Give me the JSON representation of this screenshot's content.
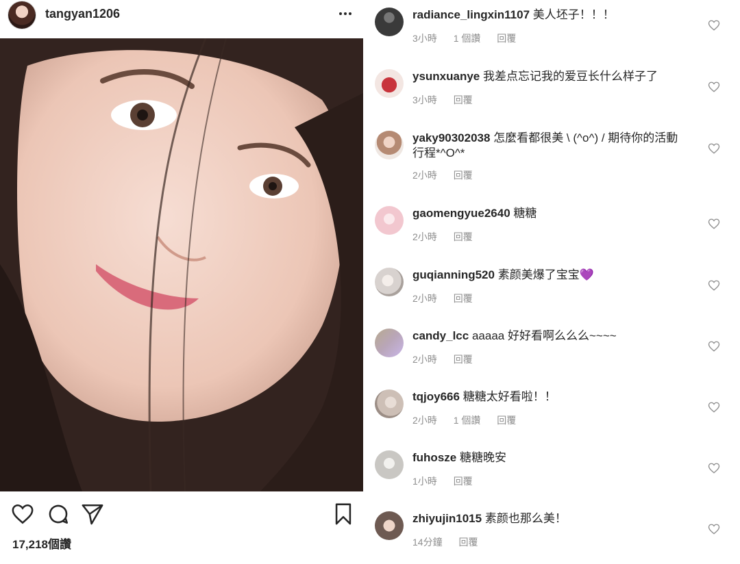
{
  "post": {
    "username": "tangyan1206",
    "likes": "17,218個讚"
  },
  "comments": [
    {
      "user": "radiance_lingxin1107",
      "text": "美人坯子！！！",
      "time": "3小時",
      "likes": "1 個讚",
      "reply": "回覆",
      "avatar_color": "#3a3a3a"
    },
    {
      "user": "ysunxuanye",
      "text": "我差点忘记我的爱豆长什么样子了",
      "time": "3小時",
      "likes": "",
      "reply": "回覆",
      "avatar_color": "#c8343c"
    },
    {
      "user": "yaky90302038",
      "text": "怎麼看都很美 \\ (^o^) /  期待你的活動行程*^O^*",
      "time": "2小時",
      "likes": "",
      "reply": "回覆",
      "avatar_color": "#b58a73"
    },
    {
      "user": "gaomengyue2640",
      "text": "糖糖",
      "time": "2小時",
      "likes": "",
      "reply": "回覆",
      "avatar_color": "#f2c7cf"
    },
    {
      "user": "guqianning520",
      "text": "素颜美爆了宝宝💜",
      "time": "2小時",
      "likes": "",
      "reply": "回覆",
      "avatar_color": "#d8d2cf"
    },
    {
      "user": "candy_lcc",
      "text": "aaaaa 好好看啊么么么~~~~",
      "time": "2小時",
      "likes": "",
      "reply": "回覆",
      "avatar_color": "#b9a6b9"
    },
    {
      "user": "tqjoy666",
      "text": "糖糖太好看啦！！",
      "time": "2小時",
      "likes": "1 個讚",
      "reply": "回覆",
      "avatar_color": "#cdbfb6"
    },
    {
      "user": "fuhosze",
      "text": "糖糖晚安",
      "time": "1小時",
      "likes": "",
      "reply": "回覆",
      "avatar_color": "#c9c7c3"
    },
    {
      "user": "zhiyujin1015",
      "text": "素颜也那么美！",
      "time": "14分鐘",
      "likes": "",
      "reply": "回覆",
      "avatar_color": "#6e5a52"
    }
  ],
  "icons": {
    "more": "more-icon",
    "like": "heart-icon",
    "comment": "comment-icon",
    "share": "share-icon",
    "save": "bookmark-icon"
  }
}
